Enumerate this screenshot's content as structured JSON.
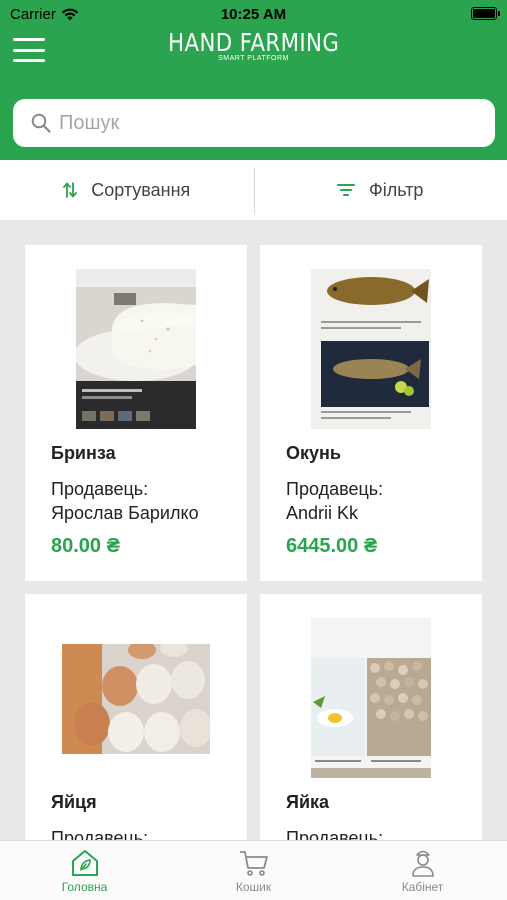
{
  "status": {
    "carrier": "Carrier",
    "time": "10:25 AM"
  },
  "header": {
    "title": "HAND FARMING",
    "subtitle": "SMART PLATFORM",
    "background": "#2aa44f"
  },
  "search": {
    "placeholder": "Пошук",
    "value": ""
  },
  "toolbar": {
    "sort_label": "Сортування",
    "filter_label": "Фільтр"
  },
  "products": [
    {
      "name": "Бринза",
      "seller_label": "Продавець:",
      "seller": "Ярослав Барилко",
      "price": "80.00 ₴"
    },
    {
      "name": "Окунь",
      "seller_label": "Продавець:",
      "seller": "Andrii Kk",
      "price": "6445.00 ₴"
    },
    {
      "name": "Яйця",
      "seller_label": "Продавець:",
      "seller": "",
      "price": ""
    },
    {
      "name": "Яйка",
      "seller_label": "Продавець:",
      "seller": "",
      "price": ""
    }
  ],
  "tabs": [
    {
      "label": "Головна",
      "icon": "home-icon",
      "active": true
    },
    {
      "label": "Кошик",
      "icon": "cart-icon",
      "active": false
    },
    {
      "label": "Кабінет",
      "icon": "profile-icon",
      "active": false
    }
  ],
  "colors": {
    "accent": "#2aa44f",
    "background": "#e8e8e8"
  }
}
